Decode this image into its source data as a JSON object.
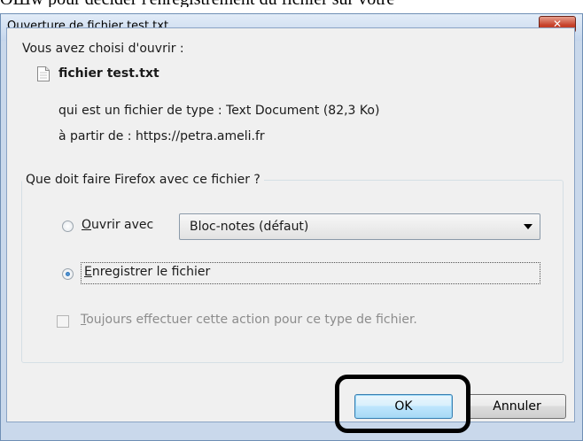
{
  "background_text": "ОШw pour décider l'enregistrement du fichier sur votre",
  "window": {
    "title": "Ouverture de fichier test.txt",
    "close_label": "✕"
  },
  "info": {
    "intro": "Vous avez choisi d'ouvrir :",
    "file_name": "fichier test.txt",
    "type_line": "qui est un fichier de type : Text Document (82,3 Ko)",
    "from_line": "à partir de : https://petra.ameli.fr"
  },
  "group": {
    "legend": "Que doit faire Firefox avec ce fichier ?",
    "open_with": {
      "accesskey": "O",
      "rest": "uvrir avec",
      "selected": false
    },
    "app_select": {
      "value": "Bloc-notes (défaut)"
    },
    "save": {
      "accesskey": "E",
      "rest": "nregistrer le fichier",
      "selected": true
    },
    "always": {
      "accesskey": "T",
      "rest": "oujours effectuer cette action pour ce type de fichier.",
      "checked": false,
      "disabled": true
    }
  },
  "buttons": {
    "ok": "OK",
    "cancel": "Annuler"
  }
}
